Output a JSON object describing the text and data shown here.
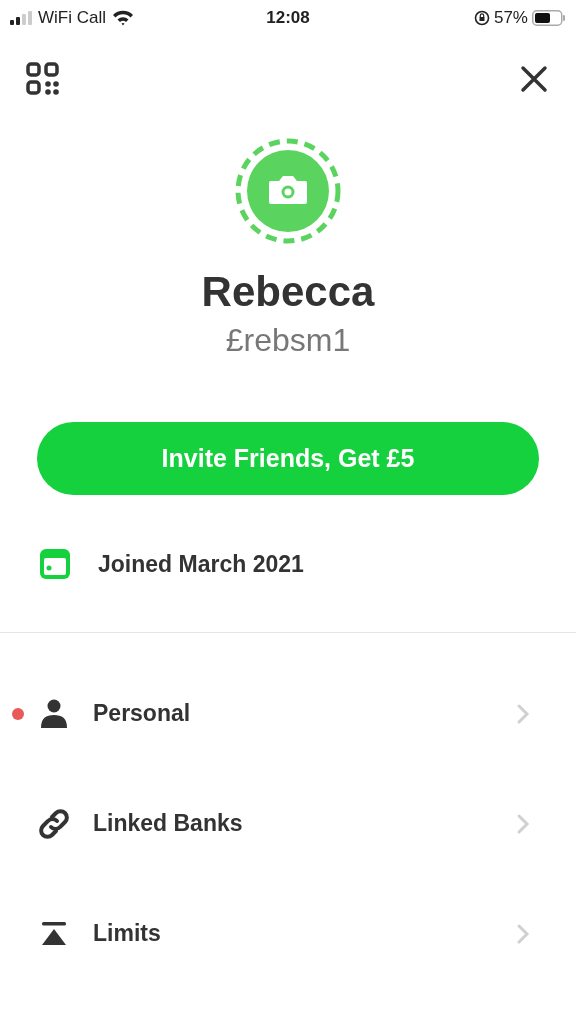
{
  "status_bar": {
    "carrier": "WiFi Call",
    "time": "12:08",
    "battery": "57%"
  },
  "profile": {
    "name": "Rebecca",
    "handle": "£rebsm1"
  },
  "invite_button": "Invite Friends, Get £5",
  "joined": "Joined March 2021",
  "menu": [
    {
      "kind": "person",
      "label": "Personal",
      "alert": true
    },
    {
      "kind": "link",
      "label": "Linked Banks",
      "alert": false
    },
    {
      "kind": "limit",
      "label": "Limits",
      "alert": false
    }
  ]
}
